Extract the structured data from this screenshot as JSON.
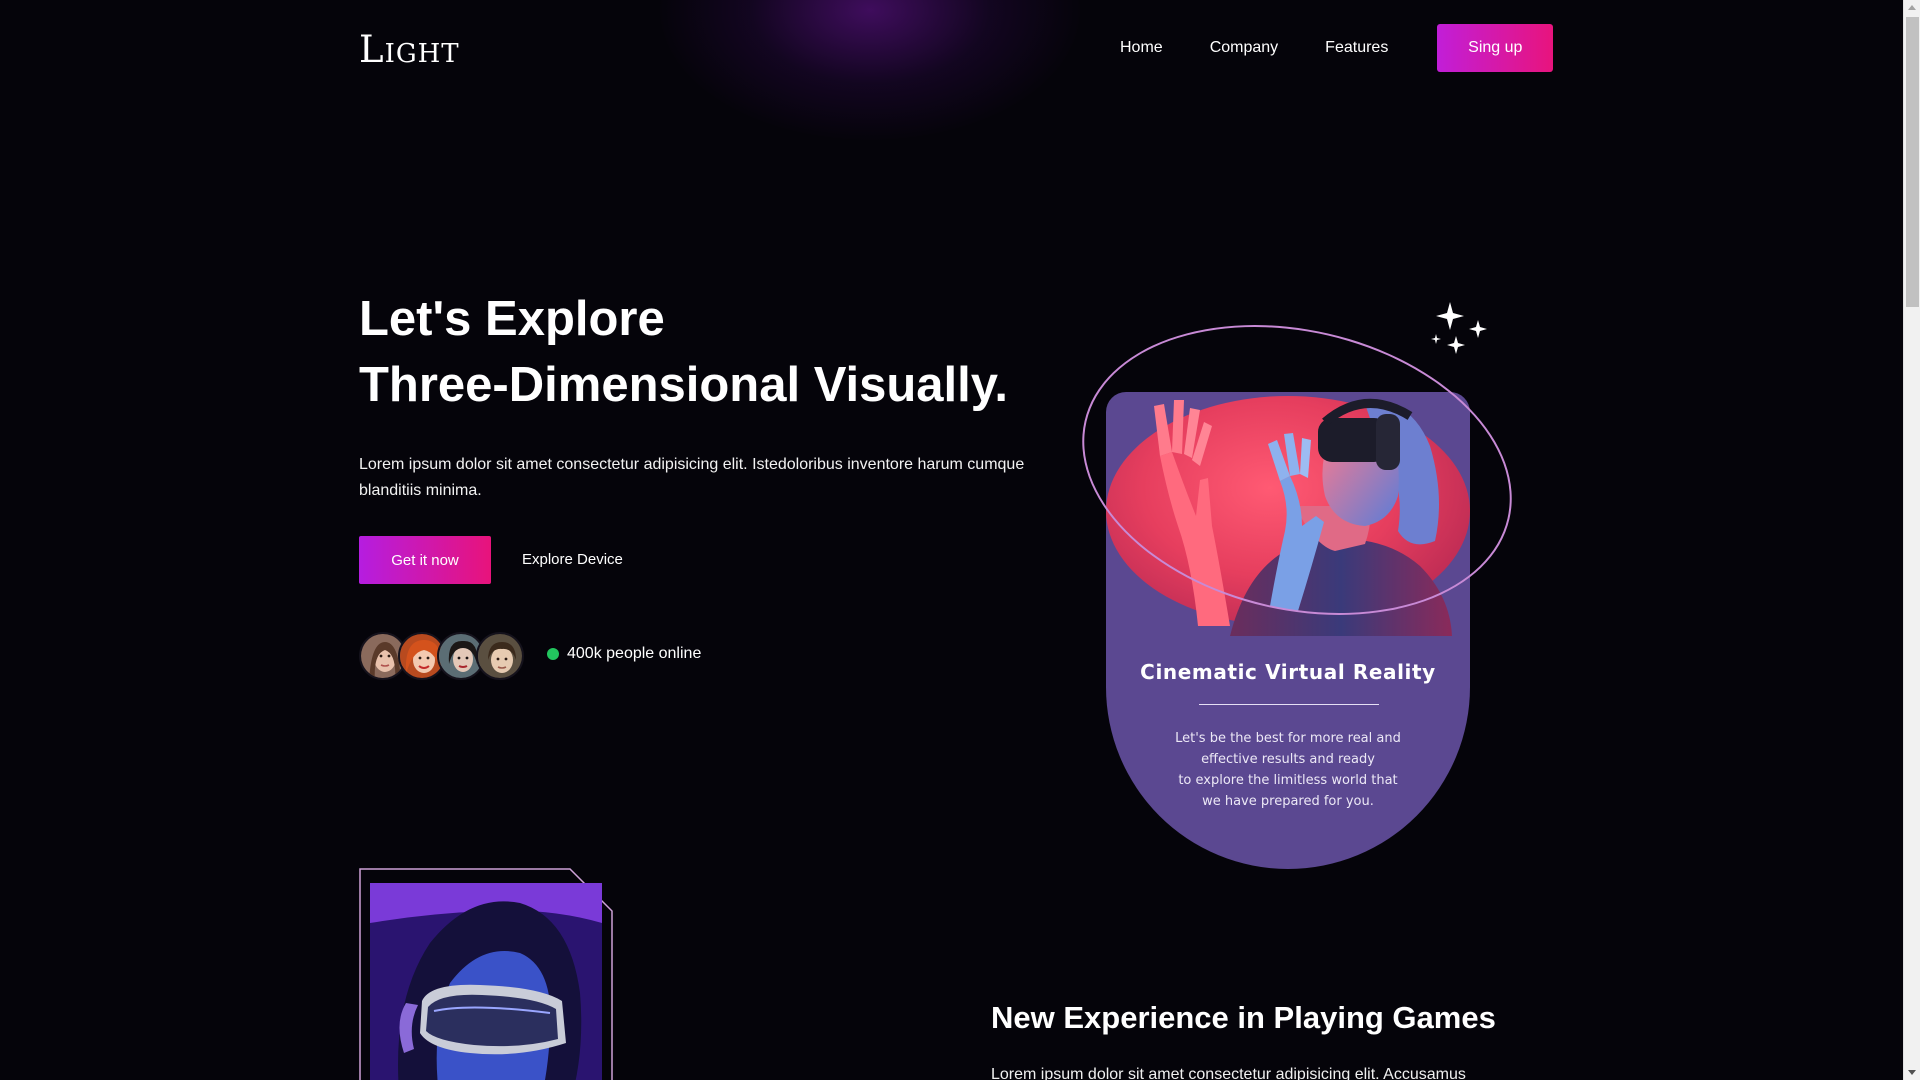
{
  "brand": {
    "logo": "Light"
  },
  "nav": {
    "items": [
      {
        "label": "Home"
      },
      {
        "label": "Company"
      },
      {
        "label": "Features"
      }
    ],
    "signup_label": "Sing up"
  },
  "hero": {
    "title_line1": "Let's Explore",
    "title_line2": "Three-Dimensional Visually.",
    "description": "Lorem ipsum dolor sit amet consectetur adipisicing elit. Istedoloribus inventore harum cumque blanditiis minima.",
    "primary_cta": "Get it now",
    "secondary_cta": "Explore Device",
    "online_text": "400k people online"
  },
  "vr_card": {
    "title": "Cinematic Virtual Reality",
    "description_line1": "Let's be the best for more real and",
    "description_line2": "effective results and ready",
    "description_line3": "to explore the limitless world that",
    "description_line4": "we have prepared for you."
  },
  "games_section": {
    "title": "New Experience in Playing Games",
    "description": "Lorem ipsum dolor sit amet consectetur adipisicing elit. Accusamus"
  },
  "colors": {
    "background": "#05040a",
    "accent_start": "#c11ed8",
    "accent_end": "#e8147d",
    "card": "#5b4891",
    "online": "#22c55e"
  },
  "icons": [
    "sparkles-icon",
    "online-dot-icon"
  ]
}
